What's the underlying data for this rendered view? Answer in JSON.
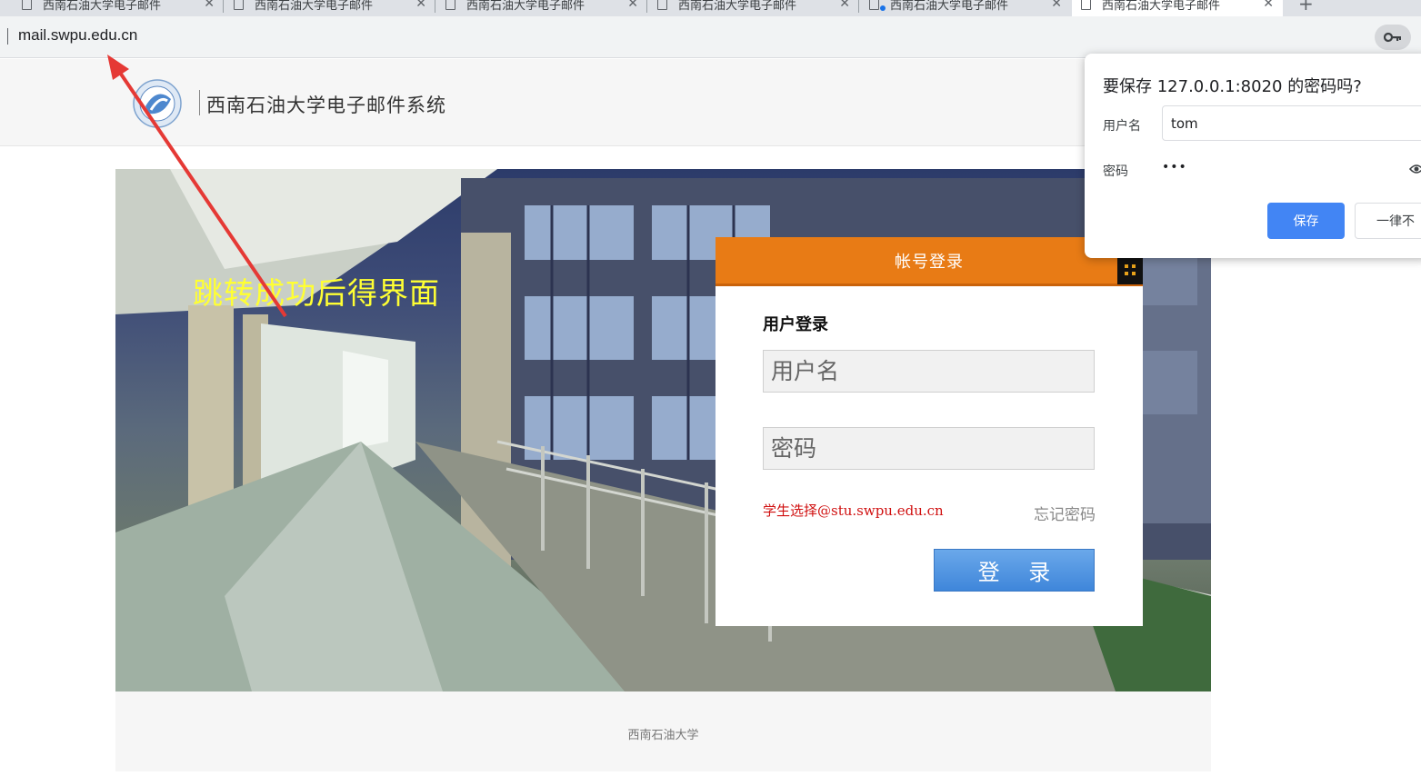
{
  "browser": {
    "tabs": [
      {
        "title": "西南石油大学电子邮件",
        "active": false
      },
      {
        "title": "西南石油大学电子邮件",
        "active": false
      },
      {
        "title": "西南石油大学电子邮件",
        "active": false
      },
      {
        "title": "西南石油大学电子邮件",
        "active": false
      },
      {
        "title": "西南石油大学电子邮件",
        "active": false
      },
      {
        "title": "西南石油大学电子邮件",
        "active": true
      }
    ],
    "new_tab": "+",
    "url": "mail.swpu.edu.cn"
  },
  "header": {
    "title": "西南石油大学电子邮件系统"
  },
  "hero": {
    "caption": "跳转成功后得界面"
  },
  "login": {
    "head": "帐号登录",
    "subtitle": "用户登录",
    "username_placeholder": "用户名",
    "password_placeholder": "密码",
    "hint": "学生选择@stu.swpu.edu.cn",
    "forgot": "忘记密码",
    "button": "登 录"
  },
  "footer": {
    "text": "西南石油大学"
  },
  "password_prompt": {
    "title": "要保存 127.0.0.1:8020 的密码吗?",
    "username_label": "用户名",
    "username_value": "tom",
    "password_label": "密码",
    "password_mask": "•••",
    "save_label": "保存",
    "never_label": "一律不"
  },
  "colors": {
    "orange": "#e87b15",
    "hint_red": "#d01010",
    "button_blue": "#3f86da",
    "caption_yellow": "#ffff33",
    "arrow_red": "#e53935"
  }
}
